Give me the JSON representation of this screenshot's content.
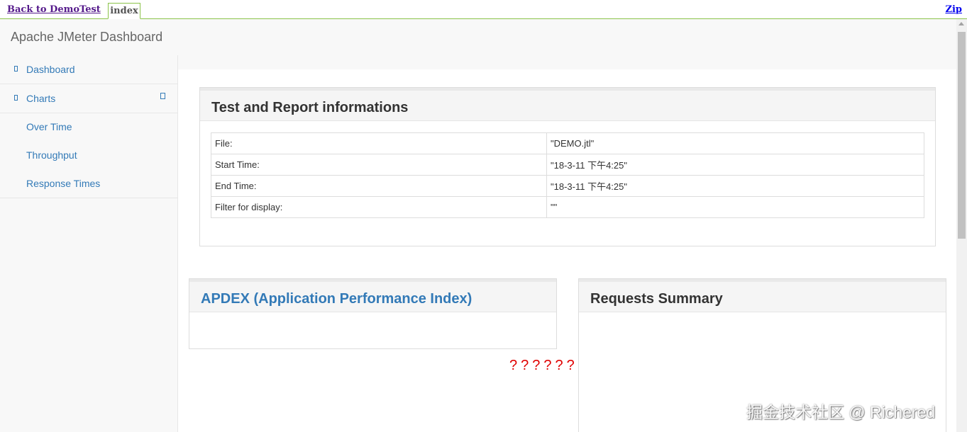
{
  "topbar": {
    "back_label": "Back to DemoTest",
    "tab_label": "index",
    "zip_label": "Zip"
  },
  "header": {
    "brand": "Apache JMeter Dashboard"
  },
  "sidebar": {
    "dashboard_label": "Dashboard",
    "charts_label": "Charts",
    "sub_items": [
      "Over Time",
      "Throughput",
      "Response Times"
    ]
  },
  "info_panel": {
    "title": "Test and Report informations",
    "rows": [
      {
        "key": "File:",
        "value": "\"DEMO.jtl\""
      },
      {
        "key": "Start Time:",
        "value": "\"18-3-11 下午4:25\""
      },
      {
        "key": "End Time:",
        "value": "\"18-3-11 下午4:25\""
      },
      {
        "key": "Filter for display:",
        "value": "\"\""
      }
    ]
  },
  "apdex_panel": {
    "title": "APDEX (Application Performance Index)"
  },
  "summary_panel": {
    "title": "Requests Summary"
  },
  "garbled_text": "??????",
  "watermark": "掘金技术社区 @ Richered",
  "colors": {
    "link": "#337ab7",
    "visited_link": "#551a8b",
    "tab_border": "#8bc34a",
    "error_text": "#e00000"
  }
}
